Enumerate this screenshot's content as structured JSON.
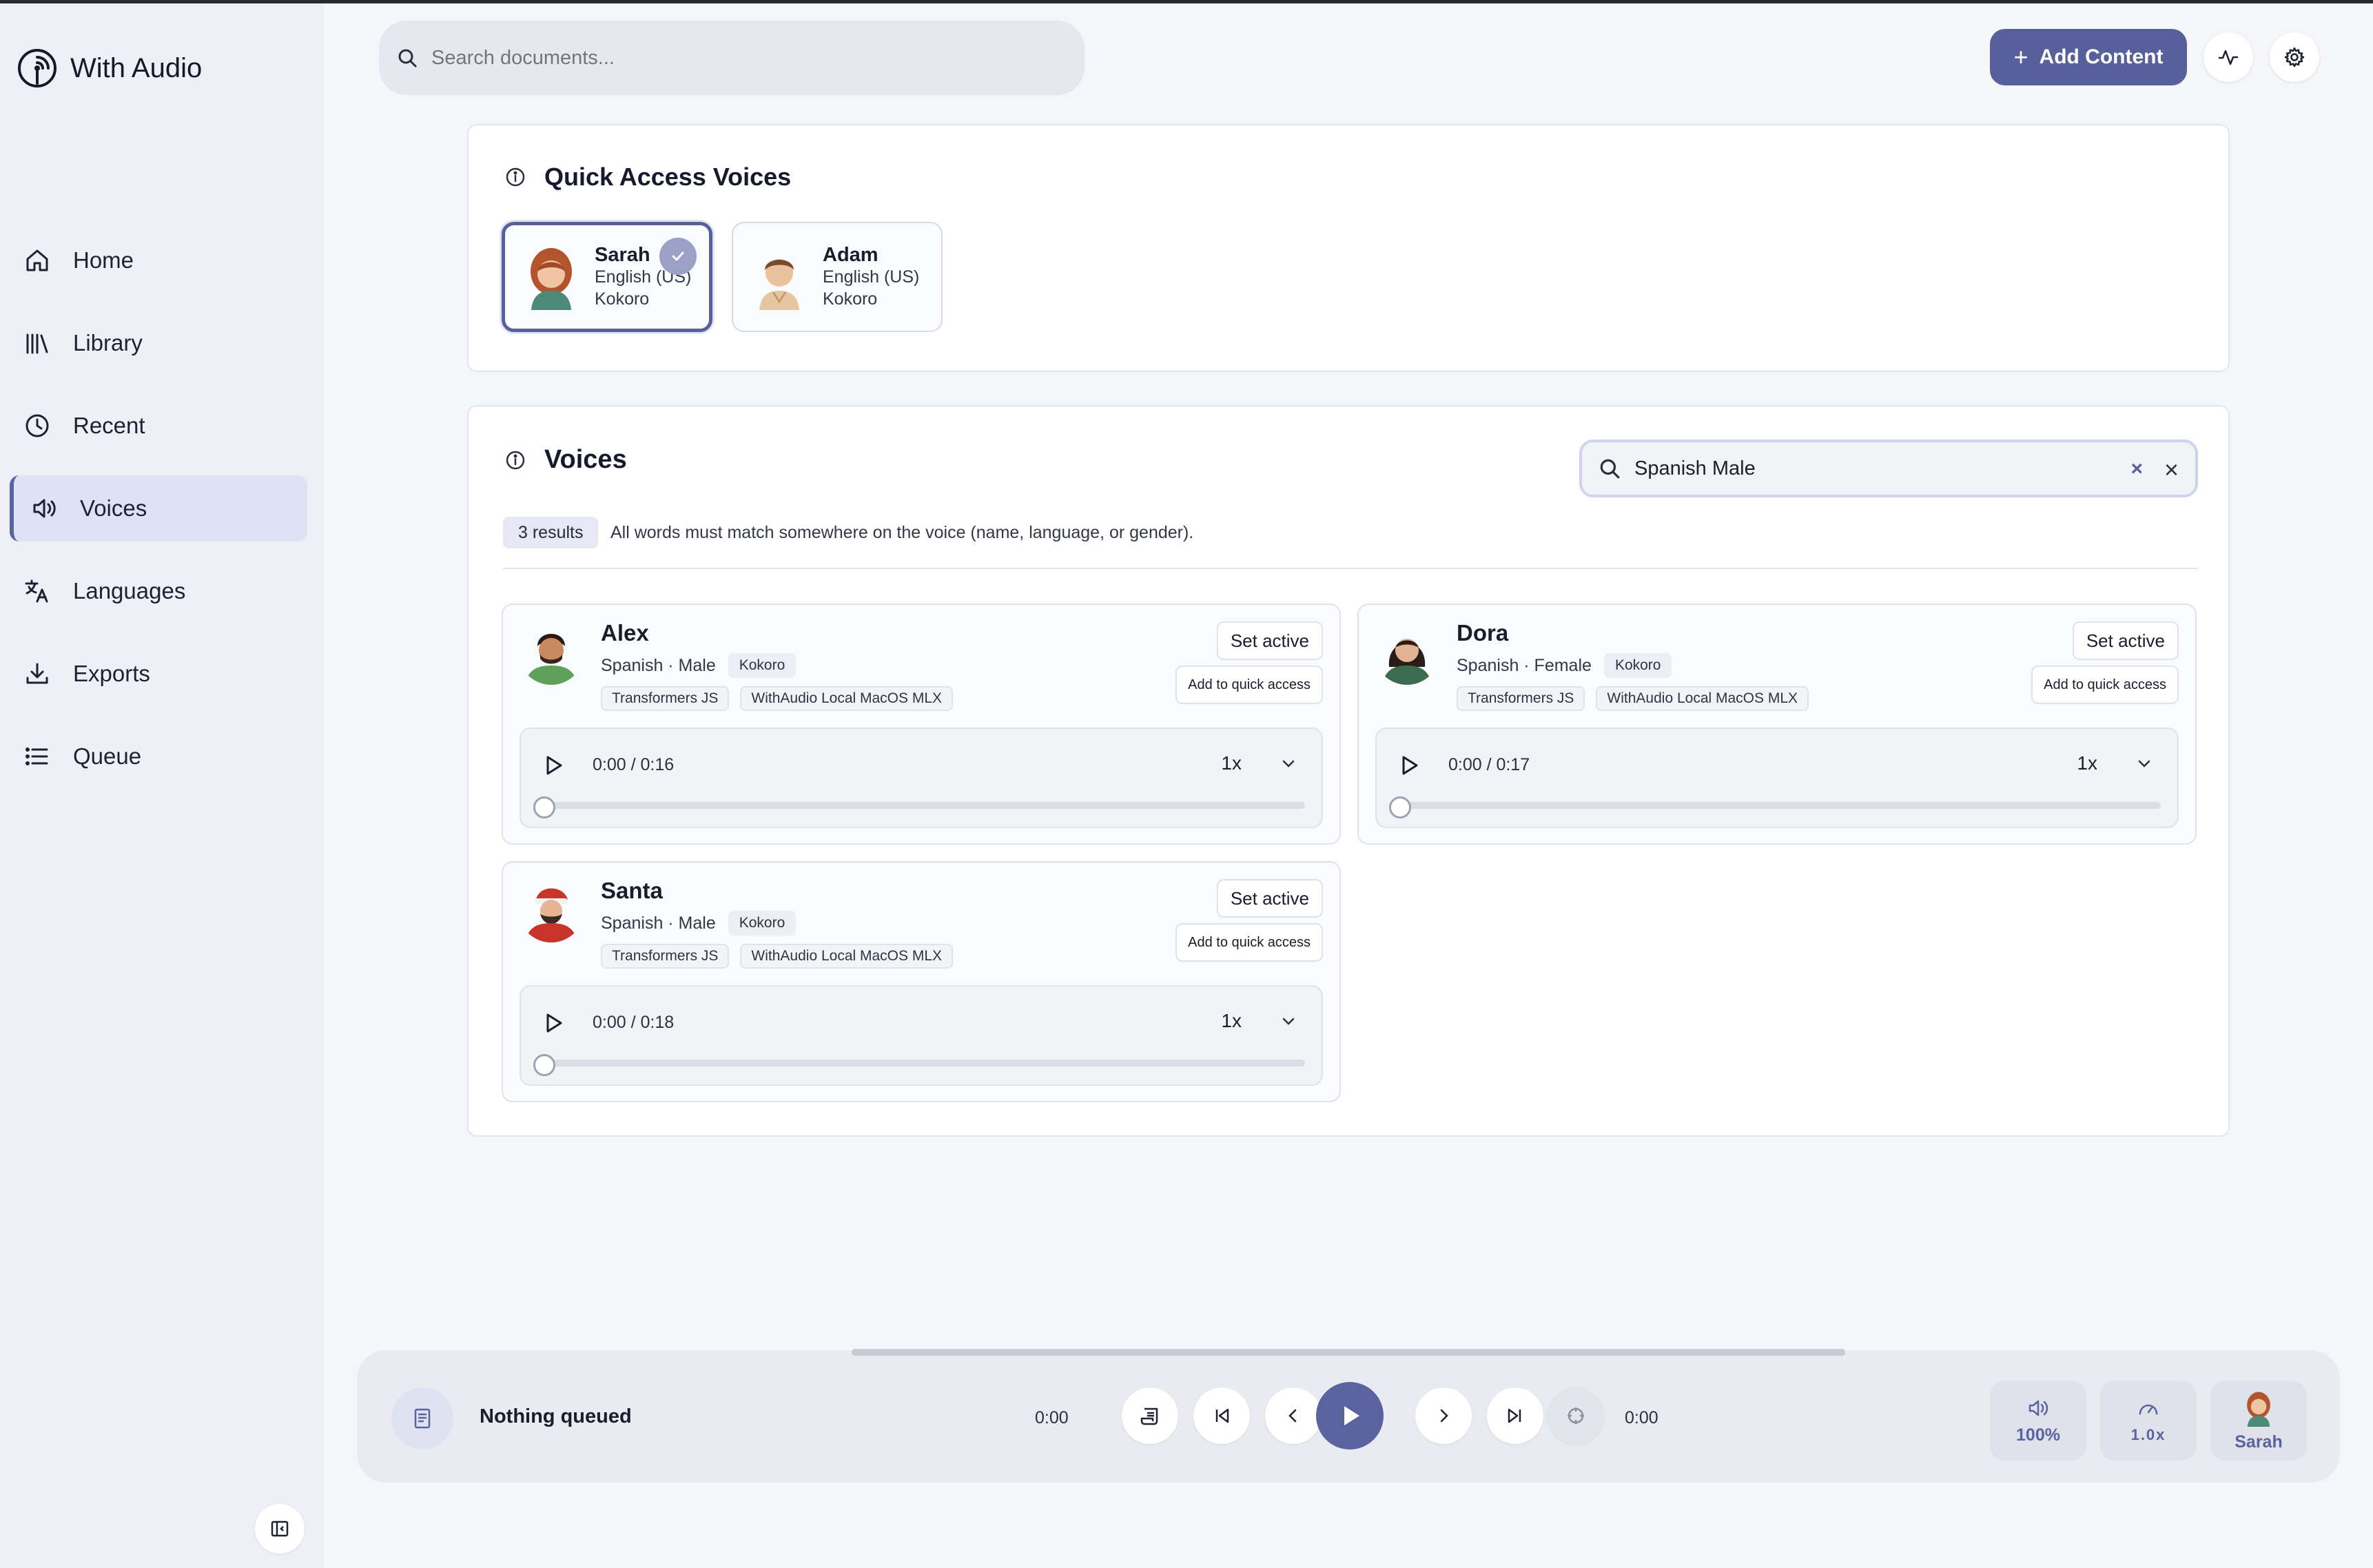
{
  "app": {
    "name": "With Audio"
  },
  "header": {
    "search_placeholder": "Search documents...",
    "add_content_label": "Add Content"
  },
  "sidebar": {
    "items": [
      {
        "label": "Home",
        "icon": "home-icon"
      },
      {
        "label": "Library",
        "icon": "library-icon"
      },
      {
        "label": "Recent",
        "icon": "clock-icon"
      },
      {
        "label": "Voices",
        "icon": "speaker-icon",
        "active": true
      },
      {
        "label": "Languages",
        "icon": "translate-icon"
      },
      {
        "label": "Exports",
        "icon": "download-icon"
      },
      {
        "label": "Queue",
        "icon": "list-icon"
      }
    ]
  },
  "quick_access": {
    "title": "Quick Access Voices",
    "voices": [
      {
        "name": "Sarah",
        "language": "English (US)",
        "engine": "Kokoro",
        "selected": true
      },
      {
        "name": "Adam",
        "language": "English (US)",
        "engine": "Kokoro",
        "selected": false
      }
    ]
  },
  "voices": {
    "title": "Voices",
    "search_value": "Spanish Male",
    "results_count": "3 results",
    "results_hint": "All words must match somewhere on the voice (name, language, or gender).",
    "set_active_label": "Set active",
    "add_quick_label": "Add to quick access",
    "cards": [
      {
        "name": "Alex",
        "language": "Spanish",
        "gender": "Male",
        "meta": "Spanish · Male",
        "engine": "Kokoro",
        "tags": [
          "Transformers JS",
          "WithAudio Local MacOS MLX"
        ],
        "time": "0:00 / 0:16",
        "speed": "1x"
      },
      {
        "name": "Dora",
        "language": "Spanish",
        "gender": "Female",
        "meta": "Spanish · Female",
        "engine": "Kokoro",
        "tags": [
          "Transformers JS",
          "WithAudio Local MacOS MLX"
        ],
        "time": "0:00 / 0:17",
        "speed": "1x"
      },
      {
        "name": "Santa",
        "language": "Spanish",
        "gender": "Male",
        "meta": "Spanish · Male",
        "engine": "Kokoro",
        "tags": [
          "Transformers JS",
          "WithAudio Local MacOS MLX"
        ],
        "time": "0:00 / 0:18",
        "speed": "1x"
      }
    ]
  },
  "player": {
    "status": "Nothing queued",
    "elapsed": "0:00",
    "remaining": "0:00",
    "volume": "100%",
    "speed": "1.0x",
    "voice": "Sarah"
  },
  "colors": {
    "accent": "#58609c",
    "sidebar_bg": "#eef0f6",
    "page_bg": "#f5f6fa"
  }
}
